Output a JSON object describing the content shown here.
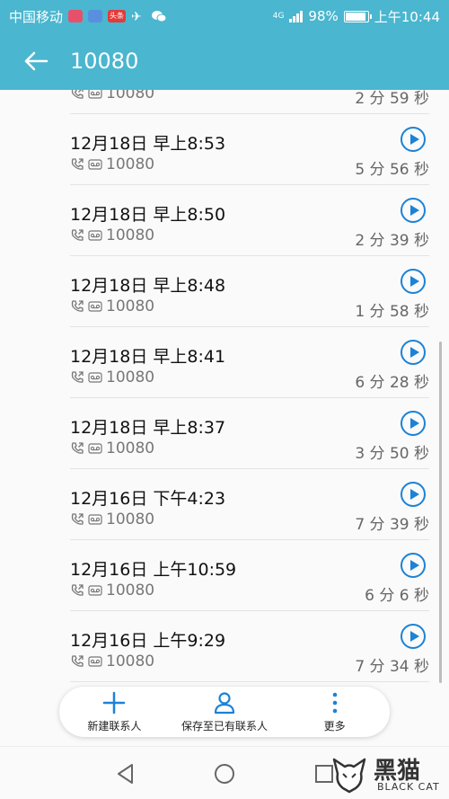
{
  "status_bar": {
    "carrier": "中国移动",
    "signal_label": "4G",
    "battery": "98%",
    "battery_level": 0.98,
    "time": "上午10:44"
  },
  "app_bar": {
    "title": "10080"
  },
  "call_log": [
    {
      "date": "",
      "number": "10080",
      "duration": "2 分 59 秒",
      "partial": true
    },
    {
      "date": "12月18日 早上8:53",
      "number": "10080",
      "duration": "5 分 56 秒"
    },
    {
      "date": "12月18日 早上8:50",
      "number": "10080",
      "duration": "2 分 39 秒"
    },
    {
      "date": "12月18日 早上8:48",
      "number": "10080",
      "duration": "1 分 58 秒"
    },
    {
      "date": "12月18日 早上8:41",
      "number": "10080",
      "duration": "6 分 28 秒"
    },
    {
      "date": "12月18日 早上8:37",
      "number": "10080",
      "duration": "3 分 50 秒"
    },
    {
      "date": "12月16日 下午4:23",
      "number": "10080",
      "duration": "7 分 39 秒"
    },
    {
      "date": "12月16日 上午10:59",
      "number": "10080",
      "duration": "6 分 6 秒"
    },
    {
      "date": "12月16日 上午9:29",
      "number": "10080",
      "duration": "7 分 34 秒"
    }
  ],
  "actions": {
    "new_contact": "新建联系人",
    "save_existing": "保存至已有联系人",
    "more": "更多"
  },
  "watermark": {
    "title": "黑猫",
    "subtitle": "BLACK CAT"
  },
  "colors": {
    "header": "#4ab6cf",
    "accent": "#1c82d6"
  }
}
